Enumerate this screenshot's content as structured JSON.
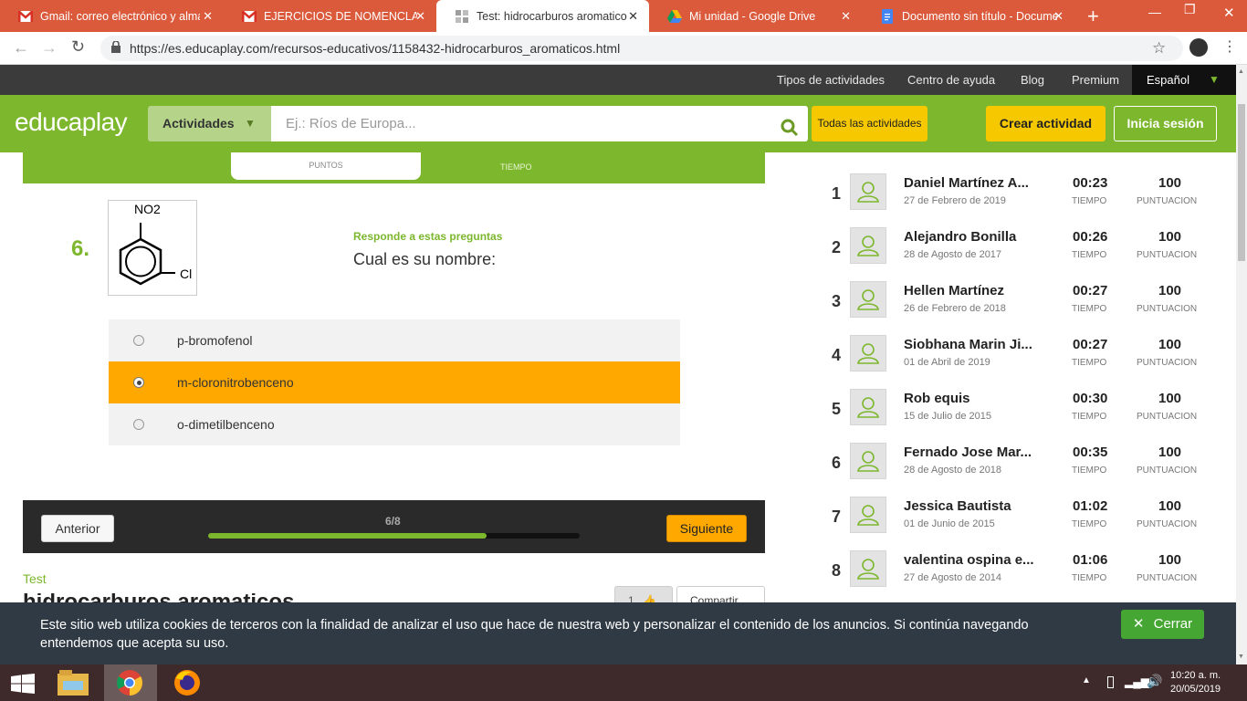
{
  "browser": {
    "tabs": [
      {
        "title": "Gmail: correo electrónico y alma",
        "icon": "gmail-icon"
      },
      {
        "title": "EJERCICIOS DE NOMENCLATUR",
        "icon": "gmail-icon"
      },
      {
        "title": "Test: hidrocarburos aromaticos (",
        "icon": "educaplay-icon",
        "active": true
      },
      {
        "title": "Mi unidad - Google Drive",
        "icon": "drive-icon"
      },
      {
        "title": "Documento sin título - Docume",
        "icon": "docs-icon"
      }
    ],
    "url": "https://es.educaplay.com/recursos-educativos/1158432-hidrocarburos_aromaticos.html"
  },
  "topnav": {
    "items": [
      "Tipos de actividades",
      "Centro de ayuda",
      "Blog",
      "Premium"
    ],
    "language": "Español"
  },
  "header": {
    "logo": "educaplay",
    "activities_button": "Actividades",
    "search_placeholder": "Ej.: Ríos de Europa...",
    "all_activities": "Todas las actividades",
    "create_activity": "Crear actividad",
    "login": "Inicia sesión"
  },
  "quiz": {
    "score_label": "PUNTOS",
    "time_label": "TIEMPO",
    "question_number": "6.",
    "instruction": "Responde a estas preguntas",
    "question": "Cual es su nombre:",
    "image_labels": {
      "top": "NO2",
      "side": "Cl"
    },
    "options": [
      {
        "label": "p-bromofenol",
        "selected": false
      },
      {
        "label": "m-cloronitrobenceno",
        "selected": true
      },
      {
        "label": "o-dimetilbenceno",
        "selected": false
      }
    ],
    "prev_button": "Anterior",
    "next_button": "Siguiente",
    "progress_text": "6/8",
    "progress": 0.75
  },
  "activity": {
    "type": "Test",
    "title": "hidrocarburos aromaticos",
    "likes": "1",
    "share": "Compartir"
  },
  "leaderboard": {
    "time_label": "TIEMPO",
    "score_label": "PUNTUACION",
    "entries": [
      {
        "rank": "1",
        "name": "Daniel Martínez A...",
        "date": "27 de Febrero de 2019",
        "time": "00:23",
        "score": "100"
      },
      {
        "rank": "2",
        "name": "Alejandro Bonilla",
        "date": "28 de Agosto de 2017",
        "time": "00:26",
        "score": "100"
      },
      {
        "rank": "3",
        "name": "Hellen Martínez",
        "date": "26 de Febrero de 2018",
        "time": "00:27",
        "score": "100"
      },
      {
        "rank": "4",
        "name": "Siobhana Marin Ji...",
        "date": "01 de Abril de 2019",
        "time": "00:27",
        "score": "100"
      },
      {
        "rank": "5",
        "name": "Rob equis",
        "date": "15 de Julio de 2015",
        "time": "00:30",
        "score": "100"
      },
      {
        "rank": "6",
        "name": "Fernado Jose Mar...",
        "date": "28 de Agosto de 2018",
        "time": "00:35",
        "score": "100"
      },
      {
        "rank": "7",
        "name": "Jessica Bautista",
        "date": "01 de Junio de 2015",
        "time": "01:02",
        "score": "100"
      },
      {
        "rank": "8",
        "name": "valentina ospina e...",
        "date": "27 de Agosto de 2014",
        "time": "01:06",
        "score": "100"
      }
    ]
  },
  "cookie": {
    "text": "Este sitio web utiliza cookies de terceros con la finalidad de analizar el uso que hace de nuestra web y personalizar el contenido de los anuncios. Si continúa navegando entendemos que acepta su uso.",
    "close": "Cerrar"
  },
  "taskbar": {
    "time": "10:20 a. m.",
    "date": "20/05/2019"
  }
}
